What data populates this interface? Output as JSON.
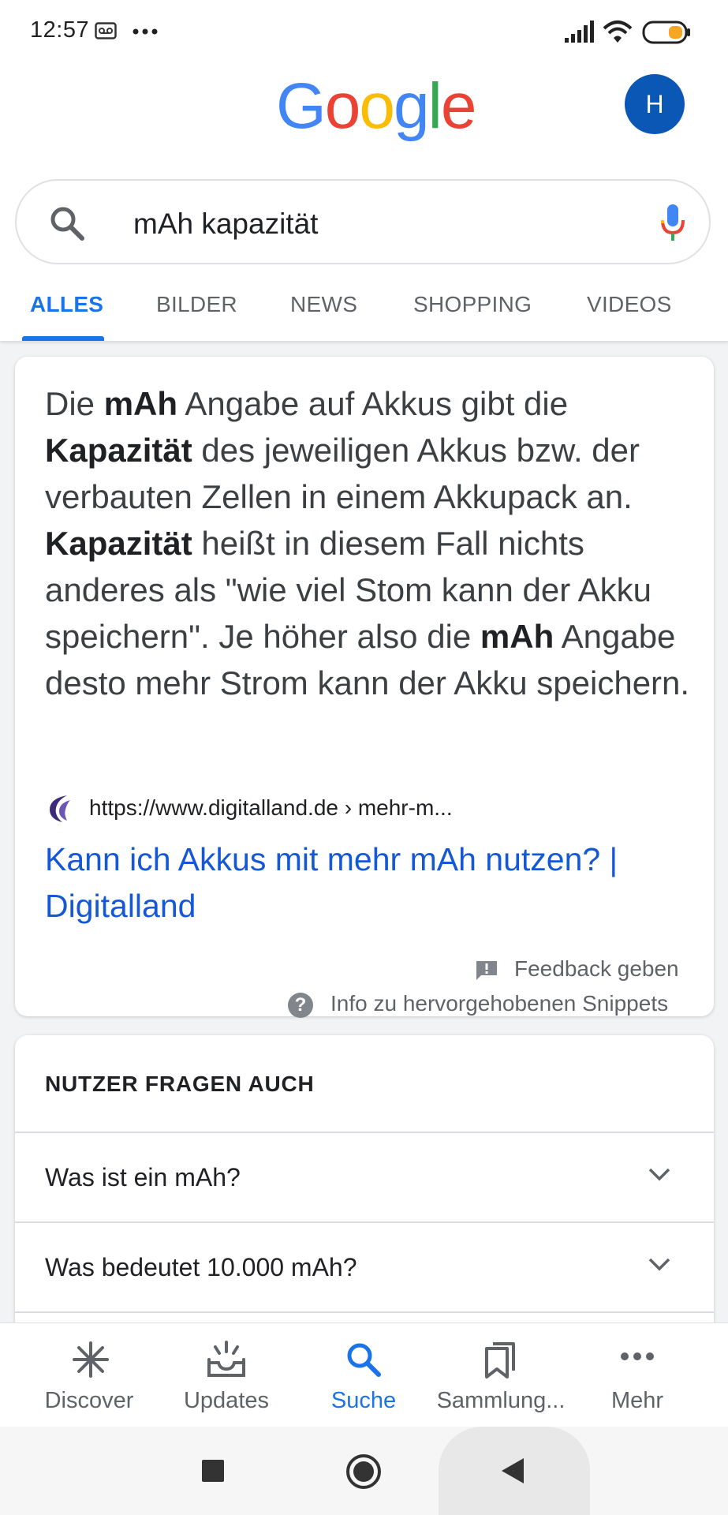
{
  "status_bar": {
    "time": "12:57"
  },
  "header": {
    "logo_letters": [
      "G",
      "o",
      "o",
      "g",
      "l",
      "e"
    ],
    "logo_colors": [
      "#4285f4",
      "#ea4335",
      "#fbbc05",
      "#4285f4",
      "#34a853",
      "#ea4335"
    ],
    "avatar_letter": "H"
  },
  "search": {
    "query": "mAh kapazität"
  },
  "tabs": [
    {
      "label": "ALLES",
      "active": true
    },
    {
      "label": "BILDER"
    },
    {
      "label": "NEWS"
    },
    {
      "label": "SHOPPING"
    },
    {
      "label": "VIDEOS"
    }
  ],
  "snippet": {
    "p1": "Die ",
    "b1": "mAh",
    "p2": " Angabe auf Akkus gibt die ",
    "b2": "Kapazität",
    "p3": " des jeweiligen Akkus bzw. der verbauten Zellen in einem Akkupack an. ",
    "b3": "Kapazität",
    "p4": " heißt in diesem Fall nichts anderes als \"wie viel Stom kann der Akku speichern\". Je höher also die ",
    "b4": "mAh",
    "p5": " Angabe desto mehr Strom kann der Akku speichern.",
    "source_url": "https://www.digitalland.de › mehr-m...",
    "source_title": "Kann ich Akkus mit mehr mAh nutzen? | Digitalland",
    "feedback": "Feedback geben",
    "info": "Info zu hervorgehobenen Snippets"
  },
  "paa": {
    "header": "NUTZER FRAGEN AUCH",
    "questions": [
      "Was ist ein mAh?",
      "Was bedeutet 10.000 mAh?"
    ]
  },
  "bottom_nav": [
    {
      "label": "Discover",
      "icon": "asterisk-icon"
    },
    {
      "label": "Updates",
      "icon": "updates-icon"
    },
    {
      "label": "Suche",
      "icon": "search-icon",
      "active": true
    },
    {
      "label": "Sammlung...",
      "icon": "bookmarks-icon"
    },
    {
      "label": "Mehr",
      "icon": "more-icon"
    }
  ],
  "colors": {
    "accent": "#1a73e8",
    "link": "#1558d6",
    "avatar": "#0b57b5"
  }
}
